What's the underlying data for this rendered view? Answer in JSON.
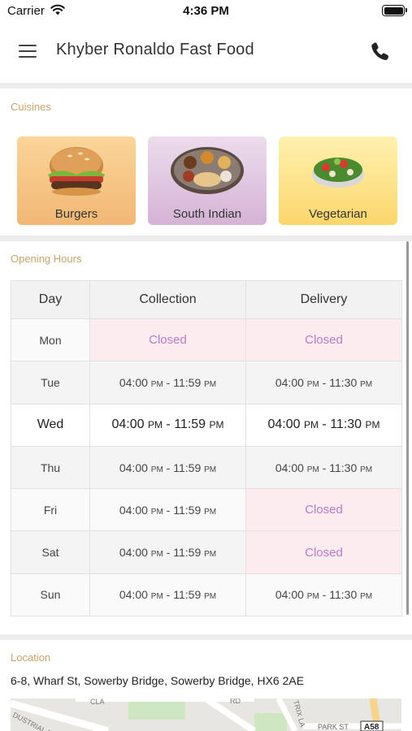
{
  "status_bar": {
    "carrier": "Carrier",
    "time": "4:36 PM"
  },
  "header": {
    "title": "Khyber Ronaldo Fast Food"
  },
  "cuisines": {
    "label": "Cuisines",
    "items": [
      {
        "name": "Burgers"
      },
      {
        "name": "South Indian"
      },
      {
        "name": "Vegetarian"
      }
    ]
  },
  "opening_hours": {
    "label": "Opening Hours",
    "columns": [
      "Day",
      "Collection",
      "Delivery"
    ],
    "rows": [
      {
        "day": "Mon",
        "collection": "Closed",
        "delivery": "Closed"
      },
      {
        "day": "Tue",
        "collection": {
          "from": "04:00",
          "from_ampm": "PM",
          "sep": " - ",
          "to": "11:59",
          "to_ampm": "PM"
        },
        "delivery": {
          "from": "04:00",
          "from_ampm": "PM",
          "sep": " - ",
          "to": "11:30",
          "to_ampm": "PM"
        }
      },
      {
        "day": "Wed",
        "collection": {
          "from": "04:00",
          "from_ampm": "PM",
          "sep": " - ",
          "to": "11:59",
          "to_ampm": "PM"
        },
        "delivery": {
          "from": "04:00",
          "from_ampm": "PM",
          "sep": " - ",
          "to": "11:30",
          "to_ampm": "PM"
        }
      },
      {
        "day": "Thu",
        "collection": {
          "from": "04:00",
          "from_ampm": "PM",
          "sep": " - ",
          "to": "11:59",
          "to_ampm": "PM"
        },
        "delivery": {
          "from": "04:00",
          "from_ampm": "PM",
          "sep": " - ",
          "to": "11:30",
          "to_ampm": "PM"
        }
      },
      {
        "day": "Fri",
        "collection": {
          "from": "04:00",
          "from_ampm": "PM",
          "sep": " - ",
          "to": "11:59",
          "to_ampm": "PM"
        },
        "delivery": "Closed"
      },
      {
        "day": "Sat",
        "collection": {
          "from": "04:00",
          "from_ampm": "PM",
          "sep": " - ",
          "to": "11:59",
          "to_ampm": "PM"
        },
        "delivery": "Closed"
      },
      {
        "day": "Sun",
        "collection": {
          "from": "04:00",
          "from_ampm": "PM",
          "sep": " - ",
          "to": "11:59",
          "to_ampm": "PM"
        },
        "delivery": {
          "from": "04:00",
          "from_ampm": "PM",
          "sep": " - ",
          "to": "11:30",
          "to_ampm": "PM"
        }
      }
    ]
  },
  "location": {
    "label": "Location",
    "address": "6-8, Wharf St, Sowerby Bridge, Sowerby Bridge, HX6 2AE",
    "map_labels": {
      "street_1": "PARK ST",
      "road_ref": "A58",
      "street_2": "DUSTRIAL R",
      "street_3": "TRIX LA",
      "street_4": "CLA",
      "street_5": "RD"
    }
  },
  "colors": {
    "section_label": "#c9a36a",
    "closed_text": "#b97bc6",
    "closed_bg": "#fcebef"
  }
}
